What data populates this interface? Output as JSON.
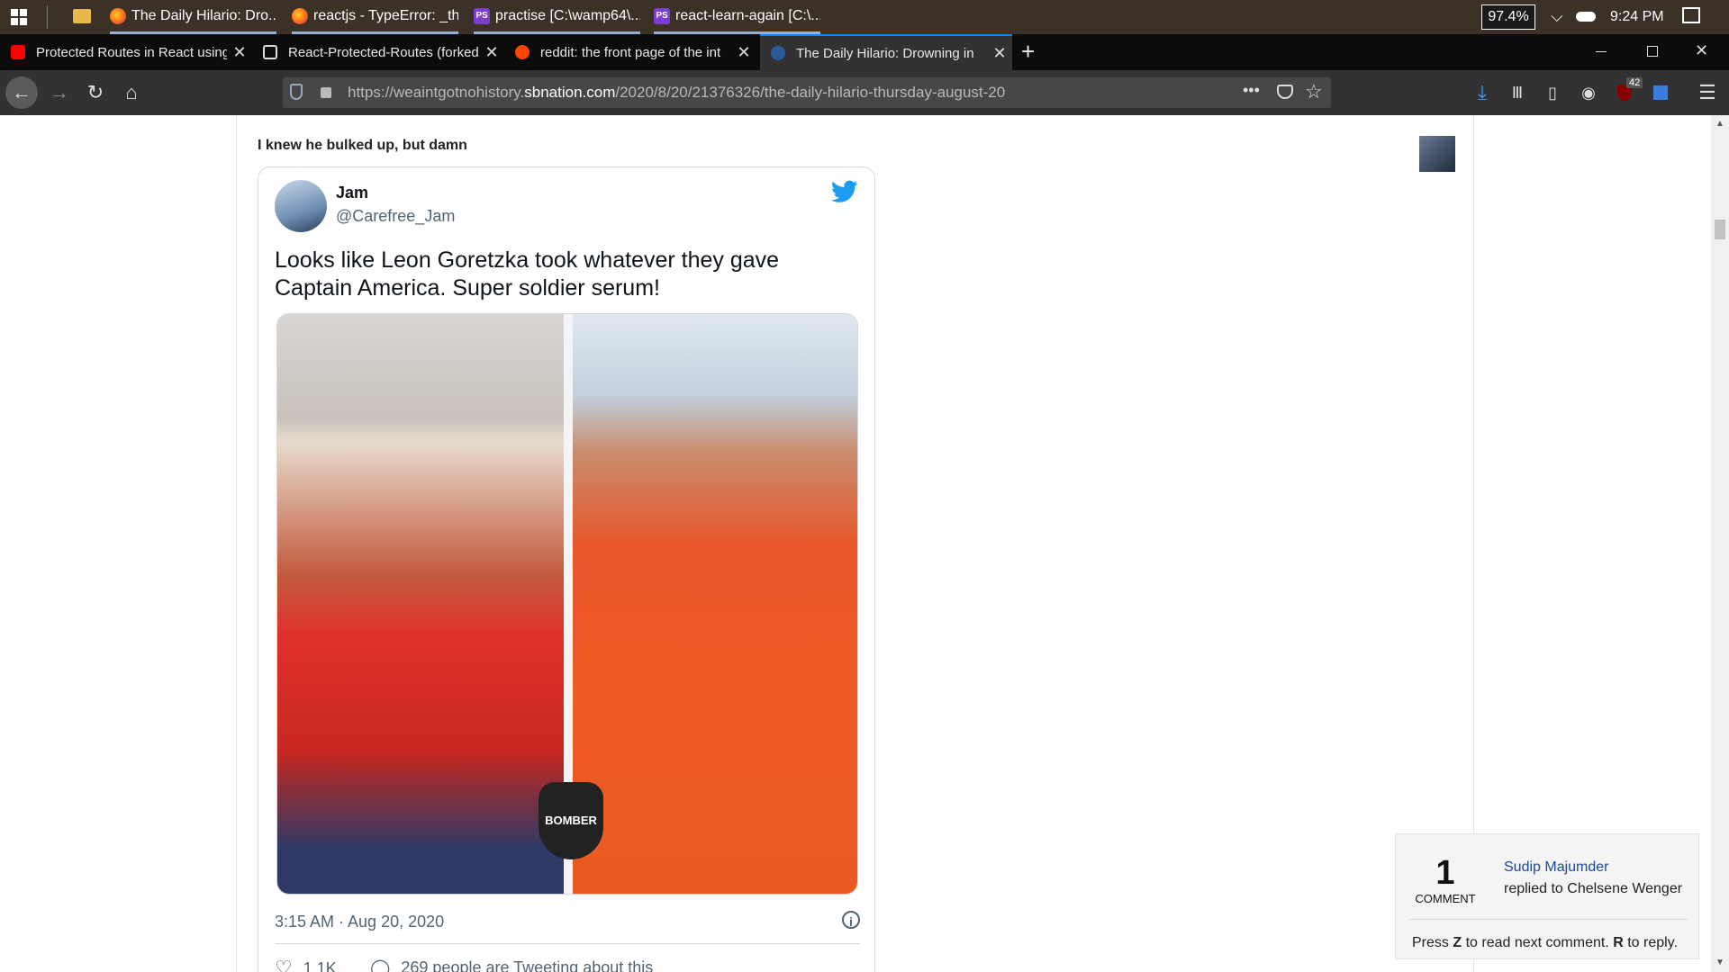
{
  "taskbar": {
    "apps": [
      {
        "label": "The Daily Hilario: Dro...",
        "icon": "firefox-icon"
      },
      {
        "label": "reactjs - TypeError: _th...",
        "icon": "firefox-icon"
      },
      {
        "label": "practise [C:\\wamp64\\...",
        "icon": "phpstorm-icon"
      },
      {
        "label": "react-learn-again [C:\\...",
        "icon": "phpstorm-icon"
      }
    ],
    "battery": "97.4%",
    "time": "9:24 PM"
  },
  "browser": {
    "tabs": [
      {
        "label": "Protected Routes in React using",
        "icon": "youtube-icon"
      },
      {
        "label": "React-Protected-Routes (forked",
        "icon": "codesandbox-icon"
      },
      {
        "label": "reddit: the front page of the int",
        "icon": "reddit-icon"
      },
      {
        "label": "The Daily Hilario: Drowning in",
        "icon": "sbnation-icon",
        "active": true
      }
    ],
    "url_prefix": "https://weaintgotnohistory.",
    "url_domain": "sbnation.com",
    "url_path": "/2020/8/20/21376326/the-daily-hilario-thursday-august-20",
    "notification_badge": "42"
  },
  "article": {
    "caption": "I knew he bulked up, but damn"
  },
  "tweet": {
    "name": "Jam",
    "handle": "@Carefree_Jam",
    "text": "Looks like Leon Goretzka took whatever they gave Captain America. Super soldier serum!",
    "watermark": "BOMBER",
    "timestamp": "3:15 AM · Aug 20, 2020",
    "likes": "1.1K",
    "talking": "269 people are Tweeting about this"
  },
  "comments": {
    "count": "1",
    "count_label": "COMMENT",
    "user": "Sudip Majumder",
    "action": "replied to Chelsene Wenger",
    "hint_pre": "Press ",
    "hint_key1": "Z",
    "hint_mid": " to read next comment. ",
    "hint_key2": "R",
    "hint_post": " to reply."
  },
  "colors": {
    "taskbar": "#3b3127",
    "tabstrip": "#0c0c0d",
    "toolbar": "#323234",
    "accent": "#0a84ff",
    "twitter_blue": "#1d9bf0",
    "comment_link": "#1a4a9a"
  }
}
